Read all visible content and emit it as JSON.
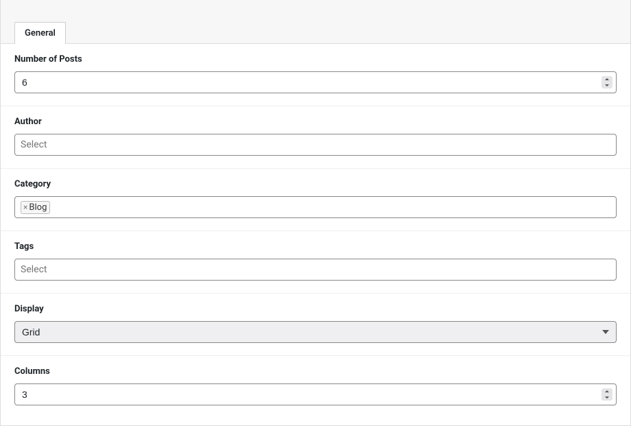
{
  "tab": {
    "general_label": "General"
  },
  "fields": {
    "number_of_posts": {
      "label": "Number of Posts",
      "value": "6"
    },
    "author": {
      "label": "Author",
      "placeholder": "Select"
    },
    "category": {
      "label": "Category",
      "selected": [
        {
          "label": "Blog"
        }
      ]
    },
    "tags": {
      "label": "Tags",
      "placeholder": "Select"
    },
    "display": {
      "label": "Display",
      "value": "Grid"
    },
    "columns": {
      "label": "Columns",
      "value": "3"
    }
  }
}
